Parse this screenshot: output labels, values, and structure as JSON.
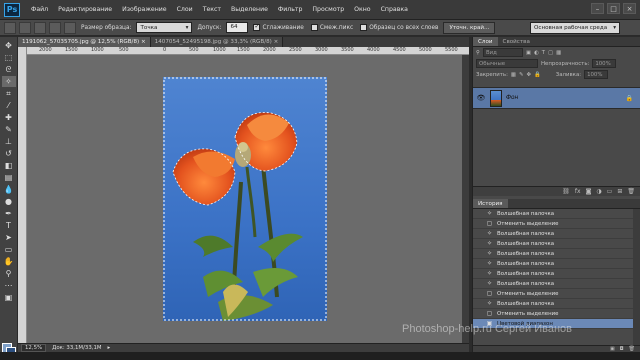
{
  "app": {
    "logo": "Ps"
  },
  "menu": [
    "Файл",
    "Редактирование",
    "Изображение",
    "Слои",
    "Текст",
    "Выделение",
    "Фильтр",
    "Просмотр",
    "Окно",
    "Справка"
  ],
  "window_controls": [
    "–",
    "□",
    "×"
  ],
  "options": {
    "sample_size_label": "Размер образца:",
    "sample_size_value": "Точка",
    "tolerance_label": "Допуск:",
    "tolerance_value": "64",
    "antialias_label": "Сглаживание",
    "contiguous_label": "Смеж.пикс",
    "sample_all_label": "Образец со всех слоев",
    "refine_button": "Уточн. край...",
    "workspace": "Основная рабочая среда"
  },
  "doc_tabs": [
    {
      "label": "1191062_57035705.jpg @ 12,5% (RGB/8) ×",
      "active": true
    },
    {
      "label": "1407054_52495198.jpg @ 33,3% (RGB/8) ×",
      "active": false
    }
  ],
  "ruler": [
    "2000",
    "1500",
    "1000",
    "500",
    "0",
    "500",
    "1000",
    "1500",
    "2000",
    "2500",
    "3000",
    "3500",
    "4000",
    "4500",
    "5000",
    "5500"
  ],
  "status": {
    "zoom": "12,5%",
    "doc": "Док: 33,1M/33,1M"
  },
  "panels": {
    "layers_tabs": [
      "Слои",
      "Свойства"
    ],
    "kind_label": "Вид",
    "blend_mode": "Обычные",
    "opacity_label": "Непрозрачность:",
    "opacity_value": "100%",
    "lock_label": "Закрепить:",
    "fill_label": "Заливка:",
    "fill_value": "100%",
    "layer_name": "Фон",
    "history_tab": "История",
    "history_items": [
      {
        "label": "Волшебная палочка",
        "icon": "magic-wand"
      },
      {
        "label": "Отменить выделение",
        "icon": "deselect"
      },
      {
        "label": "Волшебная палочка",
        "icon": "magic-wand"
      },
      {
        "label": "Волшебная палочка",
        "icon": "magic-wand"
      },
      {
        "label": "Волшебная палочка",
        "icon": "magic-wand"
      },
      {
        "label": "Волшебная палочка",
        "icon": "magic-wand"
      },
      {
        "label": "Волшебная палочка",
        "icon": "magic-wand"
      },
      {
        "label": "Волшебная палочка",
        "icon": "magic-wand"
      },
      {
        "label": "Отменить выделение",
        "icon": "deselect"
      },
      {
        "label": "Волшебная палочка",
        "icon": "magic-wand"
      },
      {
        "label": "Отменить выделение",
        "icon": "deselect"
      },
      {
        "label": "Цветовой диапазон",
        "icon": "color-range",
        "active": true
      }
    ]
  },
  "watermark": "Photoshop-help.ru Сергей Иванов"
}
